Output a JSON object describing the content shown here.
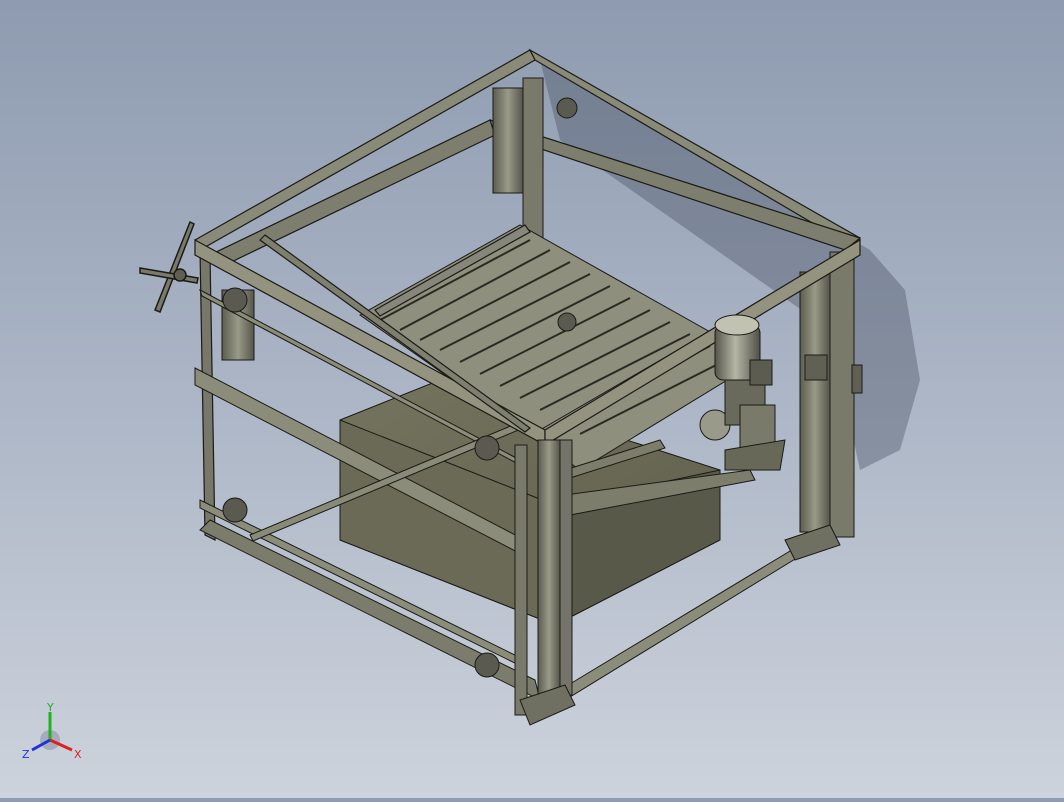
{
  "viewport": {
    "background_top": "#8e9bb0",
    "background_bottom": "#cdd3dc",
    "model_color": "#6f6f62",
    "model_edge_color": "#1b1b16"
  },
  "triad": {
    "x_label": "X",
    "y_label": "Y",
    "z_label": "Z",
    "x_color": "#e02020",
    "y_color": "#20b020",
    "z_color": "#2030e0"
  }
}
